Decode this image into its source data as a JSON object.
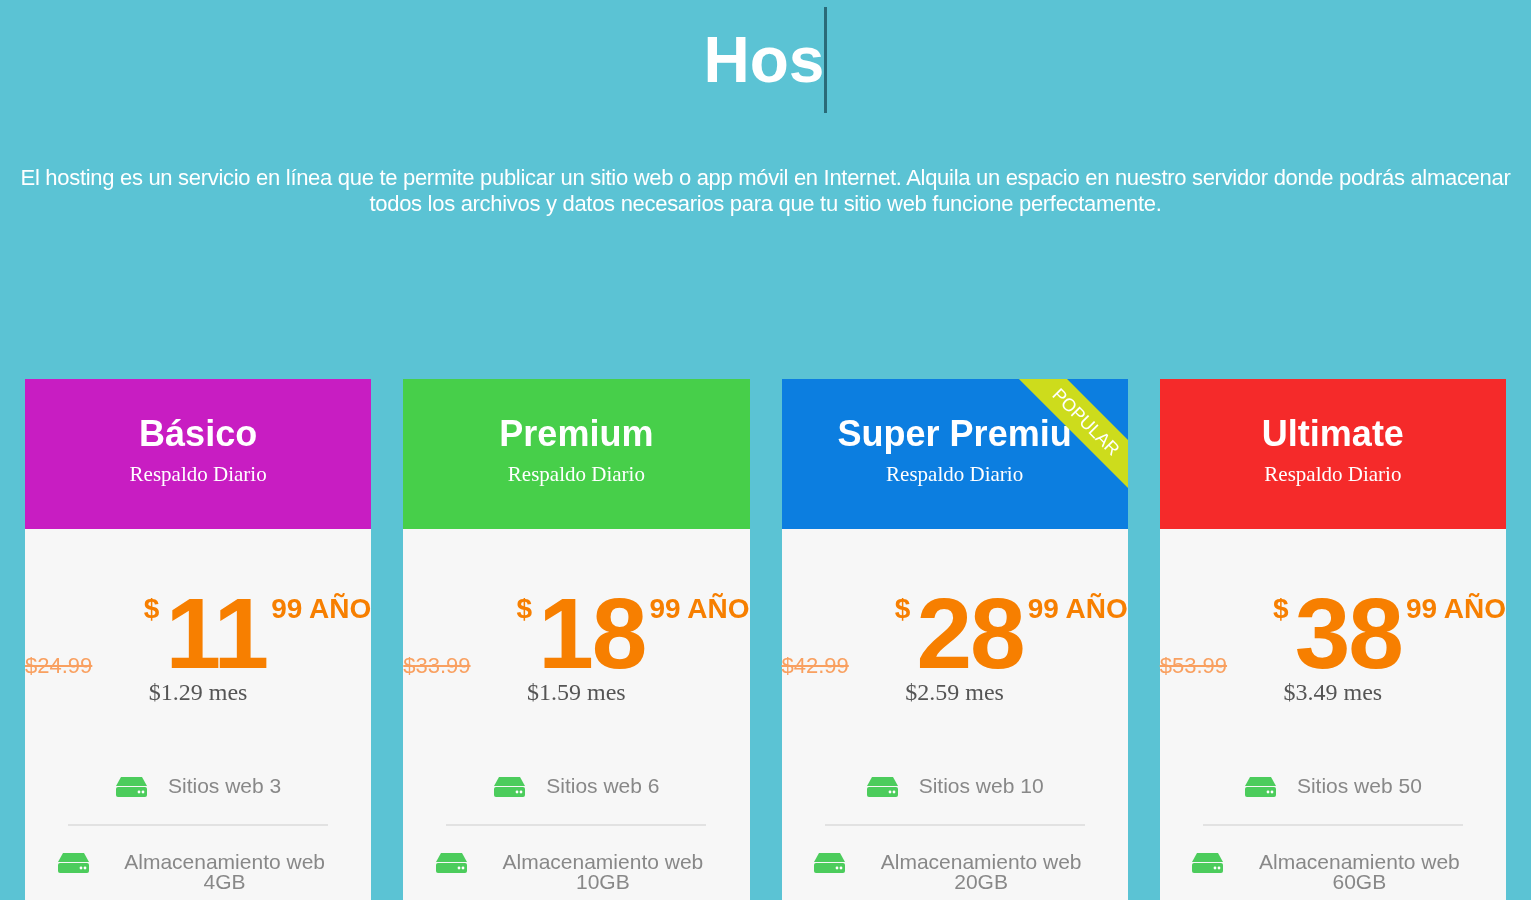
{
  "heading": {
    "title": "Hos",
    "cursor_visible": true
  },
  "description": "El hosting es un servicio en línea que te permite publicar un sitio web o app móvil en Internet. Alquila un espacio en nuestro servidor donde podrás almacenar todos los archivos y datos necesarios para que tu sitio web funcione perfectamente.",
  "plans": [
    {
      "name": "Básico",
      "subtitle": "Respaldo Diario",
      "color": "#c81dc2",
      "popular": false,
      "old_price": "$24.99",
      "currency": "$",
      "price": "11",
      "cents": "99 AÑO",
      "monthly": "$1.29 mes",
      "features": [
        "Sitios web 3",
        "Almacenamiento web 4GB"
      ]
    },
    {
      "name": "Premium",
      "subtitle": "Respaldo Diario",
      "color": "#47cf4a",
      "popular": false,
      "old_price": "$33.99",
      "currency": "$",
      "price": "18",
      "cents": "99 AÑO",
      "monthly": "$1.59 mes",
      "features": [
        "Sitios web 6",
        "Almacenamiento web 10GB"
      ]
    },
    {
      "name": "Super Premiu",
      "subtitle": "Respaldo Diario",
      "color": "#0c7ee0",
      "popular": true,
      "ribbon": "POPULAR",
      "old_price": "$42.99",
      "currency": "$",
      "price": "28",
      "cents": "99 AÑO",
      "monthly": "$2.59 mes",
      "features": [
        "Sitios web 10",
        "Almacenamiento web 20GB"
      ]
    },
    {
      "name": "Ultimate",
      "subtitle": "Respaldo Diario",
      "color": "#f52a2a",
      "popular": false,
      "old_price": "$53.99",
      "currency": "$",
      "price": "38",
      "cents": "99 AÑO",
      "monthly": "$3.49 mes",
      "features": [
        "Sitios web 50",
        "Almacenamiento web 60GB"
      ]
    }
  ]
}
